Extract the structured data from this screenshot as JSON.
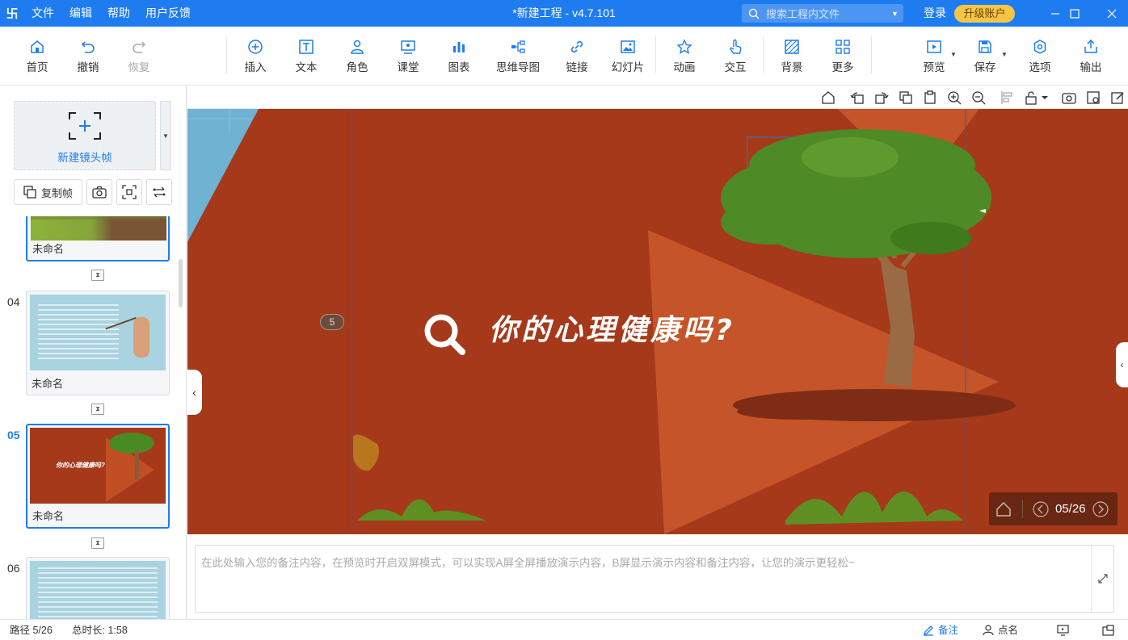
{
  "titlebar": {
    "logo": "卐",
    "menu": [
      "文件",
      "编辑",
      "帮助",
      "用户反馈"
    ],
    "title": "*新建工程 - v4.7.101",
    "search_placeholder": "搜索工程内文件",
    "login": "登录",
    "upgrade": "升级账户"
  },
  "toolbar": {
    "home": "首页",
    "undo": "撤销",
    "redo": "恢复",
    "insert": "插入",
    "text": "文本",
    "role": "角色",
    "class": "课堂",
    "chart": "图表",
    "mindmap": "思维导图",
    "link": "链接",
    "slideshow": "幻灯片",
    "animation": "动画",
    "interaction": "交互",
    "background": "背景",
    "more": "更多",
    "preview": "预览",
    "save": "保存",
    "options": "选项",
    "export": "输出"
  },
  "left": {
    "new_frame": "新建镜头帧",
    "copy_frame": "复制帧",
    "slides": [
      {
        "num": "",
        "name": "未命名"
      },
      {
        "num": "04",
        "name": "未命名"
      },
      {
        "num": "05",
        "name": "未命名",
        "thumb_text": "你的心理健康吗?"
      },
      {
        "num": "06",
        "name": ""
      }
    ]
  },
  "canvas": {
    "title": "你的心理健康吗?",
    "frame_badge": "5",
    "counter": "05/26"
  },
  "notes": {
    "placeholder": "在此处输入您的备注内容，在预览时开启双屏模式，可以实现A屏全屏播放演示内容，B屏显示演示内容和备注内容，让您的演示更轻松~"
  },
  "status": {
    "path": "路径 5/26",
    "duration": "总时长: 1:58",
    "notes": "备注",
    "rollcall": "点名"
  },
  "colors": {
    "accent": "#1f7cf0",
    "canvas_bg": "#a5391a",
    "upgrade": "#f7c544"
  }
}
